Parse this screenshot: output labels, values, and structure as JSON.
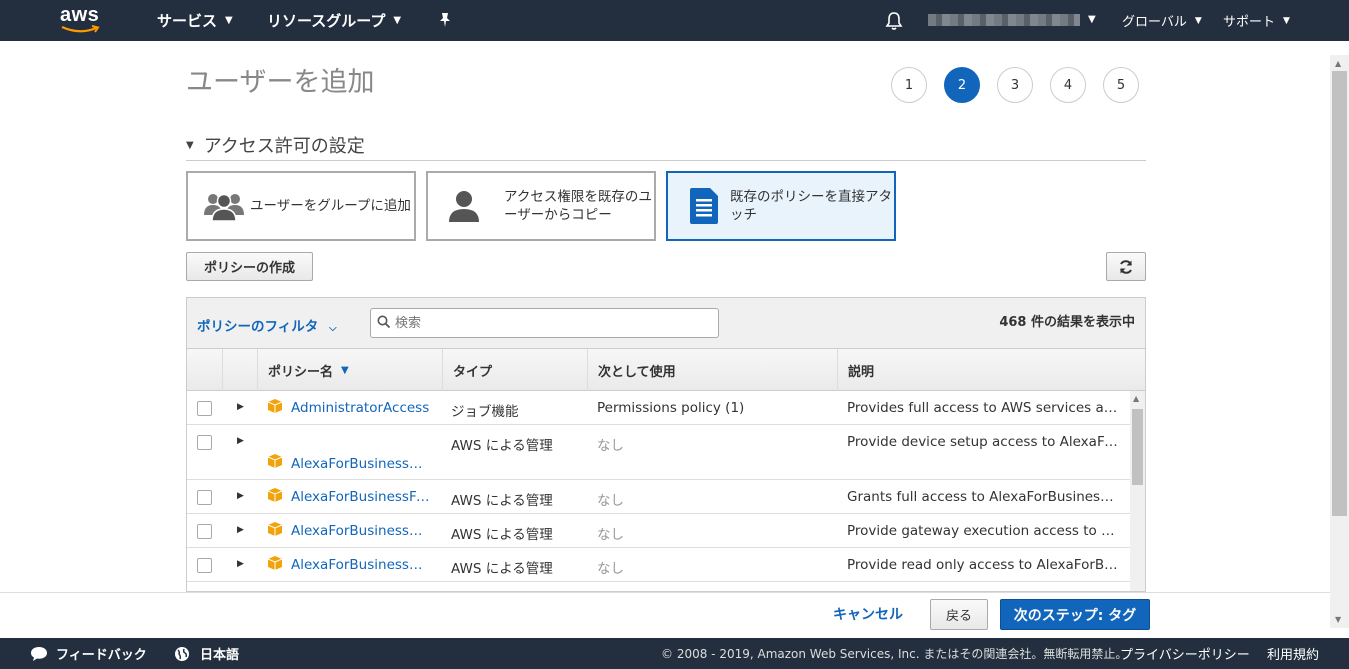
{
  "header": {
    "logo": "aws",
    "services": "サービス",
    "resource_groups": "リソースグループ",
    "region": "グローバル",
    "support": "サポート"
  },
  "page": {
    "title": "ユーザーを追加",
    "steps": [
      "1",
      "2",
      "3",
      "4",
      "5"
    ],
    "active_step": "2",
    "section_title": "アクセス許可の設定"
  },
  "options": [
    {
      "label": "ユーザーをグループに追加",
      "icon": "users-group-icon"
    },
    {
      "label": "アクセス権限を既存のユーザーからコピー",
      "icon": "user-icon"
    },
    {
      "label": "既存のポリシーを直接アタッチ",
      "icon": "document-icon",
      "selected": true
    }
  ],
  "toolbar": {
    "create_policy": "ポリシーの作成"
  },
  "filter": {
    "label": "ポリシーのフィルタ",
    "search_placeholder": "検索",
    "count": "468 件の結果を表示中"
  },
  "table": {
    "columns": [
      "ポリシー名",
      "タイプ",
      "次として使用",
      "説明"
    ],
    "rows": [
      {
        "name": "AdministratorAccess",
        "type": "ジョブ機能",
        "used_as": "Permissions policy (1)",
        "desc": "Provides full access to AWS services and resources."
      },
      {
        "name": "AlexaForBusinessDeviceSetup",
        "type": "AWS による管理",
        "used_as": "なし",
        "desc": "Provide device setup access to AlexaForBusiness services"
      },
      {
        "name": "AlexaForBusinessFullAccess",
        "type": "AWS による管理",
        "used_as": "なし",
        "desc": "Grants full access to AlexaForBusiness resources"
      },
      {
        "name": "AlexaForBusinessGatewayExecution",
        "type": "AWS による管理",
        "used_as": "なし",
        "desc": "Provide gateway execution access to AlexaForBusiness services"
      },
      {
        "name": "AlexaForBusinessReadOnlyAccess",
        "type": "AWS による管理",
        "used_as": "なし",
        "desc": "Provide read only access to AlexaForBusiness services"
      }
    ]
  },
  "actions": {
    "cancel": "キャンセル",
    "back": "戻る",
    "next": "次のステップ: タグ"
  },
  "footer": {
    "feedback": "フィードバック",
    "language": "日本語",
    "copyright": "© 2008 - 2019, Amazon Web Services, Inc. またはその関連会社。無断転用禁止。",
    "privacy": "プライバシーポリシー",
    "terms": "利用規約"
  },
  "colors": {
    "header_bg": "#232f3e",
    "accent": "#1166bb",
    "policy_icon": "#f0a30a"
  }
}
